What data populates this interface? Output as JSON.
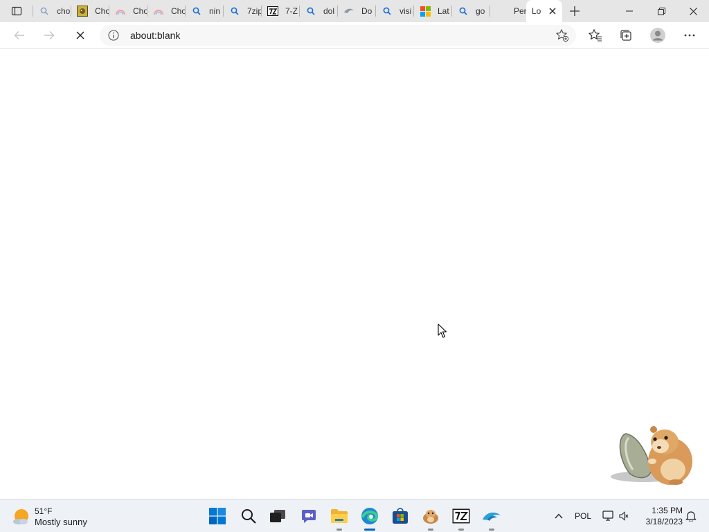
{
  "browser": {
    "tabs": [
      {
        "title": "cho",
        "icon": "search-icon"
      },
      {
        "title": "Cho",
        "icon": "game-favicon"
      },
      {
        "title": "Cho",
        "icon": "rainbow-favicon"
      },
      {
        "title": "Cho",
        "icon": "rainbow-favicon"
      },
      {
        "title": "nin",
        "icon": "search-icon"
      },
      {
        "title": "7zip",
        "icon": "search-icon"
      },
      {
        "title": "7-Z",
        "icon": "7zip-favicon"
      },
      {
        "title": "dol",
        "icon": "search-icon"
      },
      {
        "title": "Do",
        "icon": "dolphin-favicon"
      },
      {
        "title": "visi",
        "icon": "search-icon"
      },
      {
        "title": "Lat",
        "icon": "microsoft-favicon"
      },
      {
        "title": "go",
        "icon": "search-icon"
      },
      {
        "title": "Per",
        "icon": "blank-favicon"
      },
      {
        "title": "Lo",
        "icon": "loading-favicon",
        "active": true
      }
    ],
    "address": "about:blank"
  },
  "taskbar": {
    "weather": {
      "temp": "51°F",
      "desc": "Mostly sunny"
    },
    "apps": [
      "start-icon",
      "search-icon",
      "task-view-icon",
      "chat-icon",
      "file-explorer-icon",
      "edge-icon",
      "store-icon",
      "hamster-app-icon",
      "7zip-app-icon",
      "dolphin-app-icon"
    ],
    "lang": "POL",
    "clock": {
      "time": "1:35 PM",
      "date": "3/18/2023"
    }
  },
  "colors": {
    "accent": "#0067c0",
    "edge_blue": "#1f87d6",
    "weather_sun": "#f5a623"
  }
}
